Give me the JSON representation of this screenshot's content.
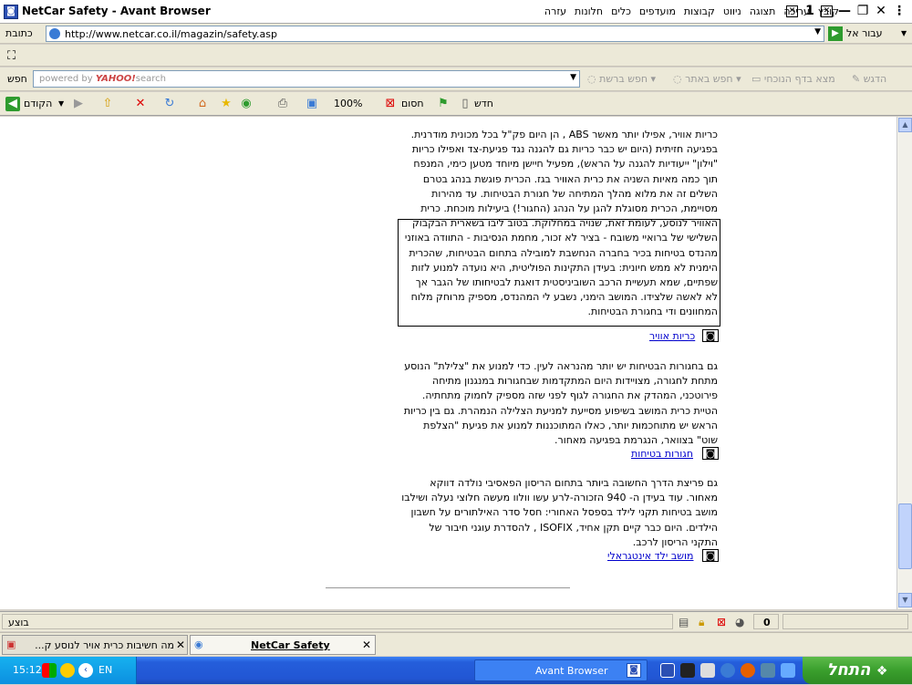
{
  "window": {
    "title": "NetCar Safety - Avant Browser",
    "menu": [
      "קובץ",
      "עריכה",
      "תצוגה",
      "ניווט",
      "קבוצות",
      "מועדפים",
      "כלים",
      "חלונות",
      "עזרה"
    ]
  },
  "address": {
    "label": "כתובת",
    "url": "http://www.netcar.co.il/magazin/safety.asp",
    "go_label": "עבור אל"
  },
  "search": {
    "label": "חפש",
    "placeholder_prefix": "powered by",
    "placeholder_brand": "YAHOO!",
    "placeholder_suffix": "search",
    "btn_web": "חפש ברשת",
    "btn_site": "חפש באתר",
    "btn_find_page": "מצא בדף הנוכחי",
    "btn_highlight": "הדגש"
  },
  "toolbar": {
    "new_label": "חדש",
    "block_label": "חסום",
    "zoom": "100%",
    "back_label": "הקודם"
  },
  "content": {
    "p1": "כריות אוויר, אפילו יותר מאשר ABS , הן היום פק\"ל בכל מכונית מודרנית. בפגיעה חזיתית (היום יש כבר כריות גם להגנה נגד פגיעת-צד ואפילו כריות \"וילון\" ייעודיות להגנה על הראש), מפעיל חיישן מיוחד מטען כימי, המנפח תוך כמה מאיות השניה את כרית האוויר בגז. הכרית פוגשת בנהג בטרם השלים זה את מלוא מהלך המתיחה של חגורת הבטיחות. עד מהירות מסויימת, הכרית מסוגלת להגן על הנהג (החגור!) ביעילות מוכחת. כרית האוויר לנוסע, לעומת זאת, שנויה במחלוקת. בטוב ליבו בשארית הבקבוק השלישי של ברואיי משובח - בציר לא זכור, מחמת הנסיבות - התוודה באוזני מהנדס בטיחות בכיר בחברה הנחשבת למובילה בתחום הבטיחות, שהכרית הימנית לא ממש חיונית: בעידן התקינות הפוליטית, היא נועדה למנוע לזות שפתיים, שמא תעשיית הרכב השוביניסטית דואגת לבטיחותו של הגבר אך לא לאשה שלצידו. המושב הימני, נשבע לי המהנדס, מספיק מרוחק מלוח המחוונים ודי בחגורת הבטיחות.",
    "link1": "כריות אוויר",
    "p2": "גם בחגורות הבטיחות יש יותר מהנראה לעין. כדי למנוע את \"צלילת\" הנוסע מתחת לחגורה, מצויידות היום המתקדמות שבחגורות במנגנון מתיחה פירוטכני, המהדק את החגורה לגוף לפני שזה מספיק לחמוק מתחתיה. הטיית כרית המושב בשיפוע מסייעת למניעת הצלילה הנמהרת. גם בין כריות הראש יש מתוחכמות יותר, כאלו המתוכננות למנוע את פגיעת \"הצלפת שוט\" בצוואר, הנגרמת בפגיעה מאחור.",
    "link2": "חגורות בטיחות",
    "p3": "גם פריצת הדרך החשובה ביותר בתחום הריסון הפאסיבי נולדה דווקא מאחור. עוד בעידן ה- 940 הזכורה-לרע עשו וולוו מעשה חלוצי נעלה ושילבו מושב בטיחות תקני לילד בספסל האחורי: חסל סדר האילתורים על חשבון הילדים. היום כבר קיים תקן אחיד, ISOFIX , להסדרת עוגני חיבור של התקני הריסון לרכב.",
    "link3": "מושב ילד אינטגראלי"
  },
  "status": {
    "text": "בוצע",
    "count": "0"
  },
  "tabs": [
    {
      "title": "מה חשיבות כרית אויר לנוסע ק..."
    },
    {
      "title": "NetCar Safety"
    }
  ],
  "taskbar": {
    "time": "15:12",
    "lang": "EN",
    "task_label": "Avant Browser",
    "start_label": "התחל"
  },
  "colors": {
    "link": "#0000cc",
    "taskbar": "#245edb",
    "start": "#3a9f2d"
  }
}
